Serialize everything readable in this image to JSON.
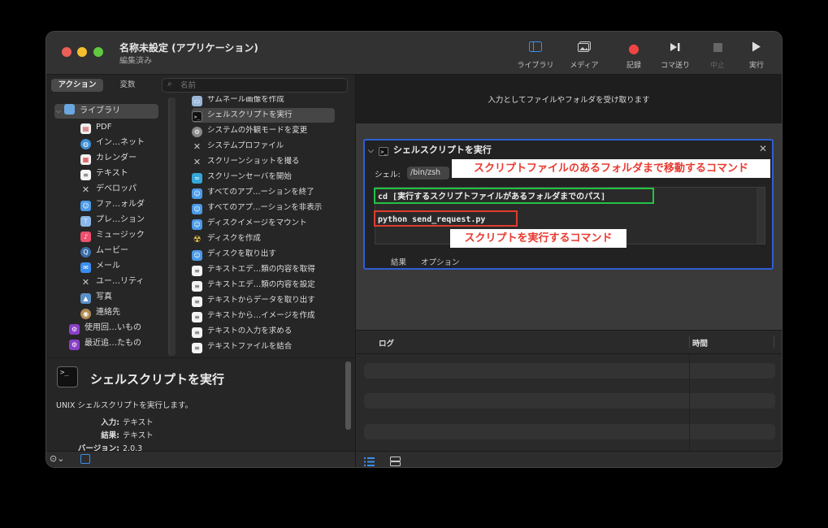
{
  "window": {
    "title": "名称未設定 (アプリケーション)",
    "subtitle": "編集済み"
  },
  "toolbar": {
    "library": "ライブラリ",
    "media": "メディア",
    "record": "記録",
    "step": "コマ送り",
    "stop": "中止",
    "run": "実行"
  },
  "left": {
    "tab_actions": "アクション",
    "tab_variables": "変数",
    "search_placeholder": "名前",
    "library_root": "ライブラリ",
    "library_items": [
      "PDF",
      "イン…ネット",
      "カレンダー",
      "テキスト",
      "デベロッパ",
      "ファ…ォルダ",
      "プレ…ション",
      "ミュージック",
      "ムービー",
      "メール",
      "ユー…リティ",
      "写真",
      "連絡先"
    ],
    "smart_items": [
      "使用回…いもの",
      "最近追…たもの"
    ],
    "actions": [
      "サムネール画像を作成",
      "シェルスクリプトを実行",
      "システムの外観モードを変更",
      "システムプロファイル",
      "スクリーンショットを撮る",
      "スクリーンセーバを開始",
      "すべてのアプ…ーションを終了",
      "すべてのアプ…ーションを非表示",
      "ディスクイメージをマウント",
      "ディスクを作成",
      "ディスクを取り出す",
      "テキストエデ…類の内容を取得",
      "テキストエデ…類の内容を設定",
      "テキストからデータを取り出す",
      "テキストから…イメージを作成",
      "テキストの入力を求める",
      "テキストファイルを結合"
    ]
  },
  "description": {
    "icon_text": ">_",
    "title": "シェルスクリプトを実行",
    "text": "UNIX シェルスクリプトを実行します。",
    "input_label": "入力:",
    "input_value": "テキスト",
    "result_label": "結果:",
    "result_value": "テキスト",
    "version_label": "バージョン:",
    "version_value": "2.0.3"
  },
  "workflow": {
    "input_header": "入力としてファイルやフォルダを受け取ります",
    "action_title": "シェルスクリプトを実行",
    "shell_label": "シェル:",
    "shell_value": "/bin/zsh",
    "code_line1": "cd [実行するスクリプトファイルがあるフォルダまでのパス]",
    "code_line2": "python send_request.py",
    "annotation1": "スクリプトファイルのあるフォルダまで移動するコマンド",
    "annotation2": "スクリプトを実行するコマンド",
    "tab_results": "結果",
    "tab_options": "オプション"
  },
  "log": {
    "col_log": "ログ",
    "col_time": "時間"
  },
  "colors": {
    "accent_blue": "#2d5fd3",
    "highlight_green": "#23c343",
    "highlight_red": "#e23b2e",
    "annotation_text": "#e83a30"
  }
}
